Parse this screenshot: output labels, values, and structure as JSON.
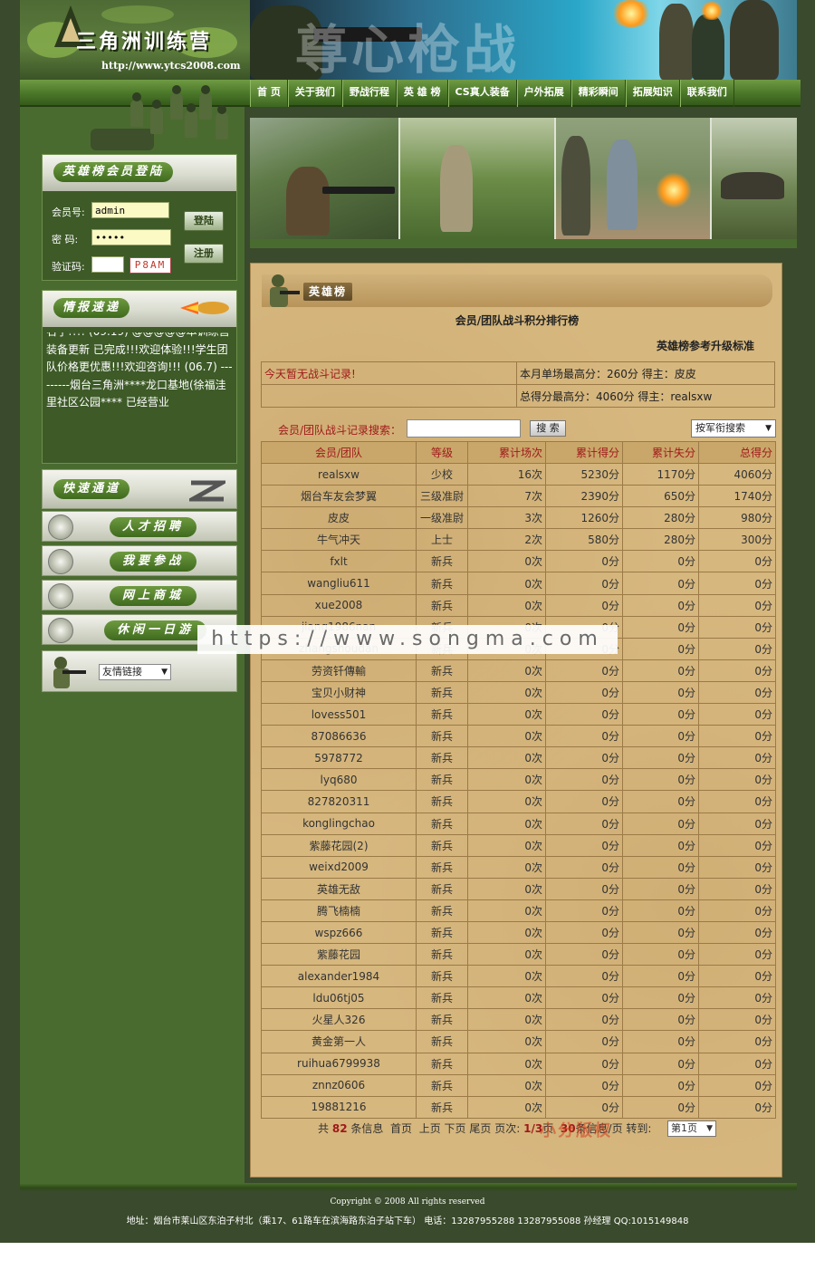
{
  "brand": {
    "title": "三角洲训练营",
    "url": "http://www.ytcs2008.com",
    "banner_text": "尊心枪战"
  },
  "nav": [
    "首 页",
    "关于我们",
    "野战行程",
    "英 雄 榜",
    "CS真人装备",
    "户外拓展",
    "精彩瞬间",
    "拓展知识",
    "联系我们"
  ],
  "login": {
    "heading": "英雄榜会员登陆",
    "member_label": "会员号:",
    "member_value": "admin",
    "password_label": "密  码:",
    "password_value": "•••••",
    "captcha_label": "验证码:",
    "captcha_value": "",
    "captcha_code": "P8AM",
    "login_button": "登陆",
    "register_button": "注册"
  },
  "news": {
    "heading": "情报速递",
    "text": "名了!!!! (09.19) @@@@@本训练营装备更新 已完成!!!欢迎体验!!!学生团队价格更优惠!!!欢迎咨询!!! (06.7) ---------烟台三角洲****龙口基地(徐福洼里社区公园**** 已经营业"
  },
  "quick": {
    "heading": "快速通道",
    "items": [
      "人才招聘",
      "我要参战",
      "网上商城",
      "休闲一日游"
    ]
  },
  "links": {
    "select_label": "友情链接"
  },
  "content": {
    "header_title": "英雄榜",
    "ranking_title": "会员/团队战斗积分排行榜",
    "upgrade_link": "英雄榜参考升级标准",
    "today_record": "今天暂无战斗记录!",
    "month_best": "本月单场最高分：260分  得主：皮皮",
    "total_best": "总得分最高分：4060分  得主：realsxw",
    "search_label": "会员/团队战斗记录搜索：",
    "search_value": "",
    "search_button": "搜 索",
    "search_select": "按军衔搜索"
  },
  "table": {
    "headers": [
      "会员/团队",
      "等级",
      "累计场次",
      "累计得分",
      "累计失分",
      "总得分"
    ],
    "rows": [
      [
        "realsxw",
        "少校",
        "16次",
        "5230分",
        "1170分",
        "4060分"
      ],
      [
        "烟台车友会梦翼",
        "三级准尉",
        "7次",
        "2390分",
        "650分",
        "1740分"
      ],
      [
        "皮皮",
        "一级准尉",
        "3次",
        "1260分",
        "280分",
        "980分"
      ],
      [
        "牛气冲天",
        "上士",
        "2次",
        "580分",
        "280分",
        "300分"
      ],
      [
        "fxlt",
        "新兵",
        "0次",
        "0分",
        "0分",
        "0分"
      ],
      [
        "wangliu611",
        "新兵",
        "0次",
        "0分",
        "0分",
        "0分"
      ],
      [
        "xue2008",
        "新兵",
        "0次",
        "0分",
        "0分",
        "0分"
      ],
      [
        "jiang1986nan",
        "新兵",
        "0次",
        "0分",
        "0分",
        "0分"
      ],
      [
        "zhangshoudan",
        "新兵",
        "0次",
        "0分",
        "0分",
        "0分"
      ],
      [
        "劳资钎傳輸",
        "新兵",
        "0次",
        "0分",
        "0分",
        "0分"
      ],
      [
        "宝贝小财神",
        "新兵",
        "0次",
        "0分",
        "0分",
        "0分"
      ],
      [
        "lovess501",
        "新兵",
        "0次",
        "0分",
        "0分",
        "0分"
      ],
      [
        "87086636",
        "新兵",
        "0次",
        "0分",
        "0分",
        "0分"
      ],
      [
        "5978772",
        "新兵",
        "0次",
        "0分",
        "0分",
        "0分"
      ],
      [
        "lyq680",
        "新兵",
        "0次",
        "0分",
        "0分",
        "0分"
      ],
      [
        "827820311",
        "新兵",
        "0次",
        "0分",
        "0分",
        "0分"
      ],
      [
        "konglingchao",
        "新兵",
        "0次",
        "0分",
        "0分",
        "0分"
      ],
      [
        "紫藤花园(2)",
        "新兵",
        "0次",
        "0分",
        "0分",
        "0分"
      ],
      [
        "weixd2009",
        "新兵",
        "0次",
        "0分",
        "0分",
        "0分"
      ],
      [
        "英雄无敌",
        "新兵",
        "0次",
        "0分",
        "0分",
        "0分"
      ],
      [
        "腾飞楠楠",
        "新兵",
        "0次",
        "0分",
        "0分",
        "0分"
      ],
      [
        "wspz666",
        "新兵",
        "0次",
        "0分",
        "0分",
        "0分"
      ],
      [
        "紫藤花园",
        "新兵",
        "0次",
        "0分",
        "0分",
        "0分"
      ],
      [
        "alexander1984",
        "新兵",
        "0次",
        "0分",
        "0分",
        "0分"
      ],
      [
        "ldu06tj05",
        "新兵",
        "0次",
        "0分",
        "0分",
        "0分"
      ],
      [
        "火星人326",
        "新兵",
        "0次",
        "0分",
        "0分",
        "0分"
      ],
      [
        "黄金第一人",
        "新兵",
        "0次",
        "0分",
        "0分",
        "0分"
      ],
      [
        "ruihua6799938",
        "新兵",
        "0次",
        "0分",
        "0分",
        "0分"
      ],
      [
        "znnz0606",
        "新兵",
        "0次",
        "0分",
        "0分",
        "0分"
      ],
      [
        "19881216",
        "新兵",
        "0次",
        "0分",
        "0分",
        "0分"
      ]
    ]
  },
  "pager": {
    "prefix": "共",
    "total": "82",
    "total_suffix": "条信息",
    "first": "首页",
    "prev": "上页",
    "next": "下页",
    "last": "尾页",
    "page_label": "页次:",
    "page": "1/3",
    "page_suffix": "页",
    "per_page": "30",
    "per_page_suffix": "条信息/页",
    "goto_label": "转到:",
    "goto_select": "第1页"
  },
  "footer": {
    "copyright": "Copyright © 2008 All rights reserved",
    "address": "地址：烟台市莱山区东泊子村北（乘17、61路车在滨海路东泊子站下车） 电话：13287955288 13287955088 孙经理 QQ:1015149848"
  },
  "watermark": "https://www.songma.com",
  "stamp": "小分版权"
}
